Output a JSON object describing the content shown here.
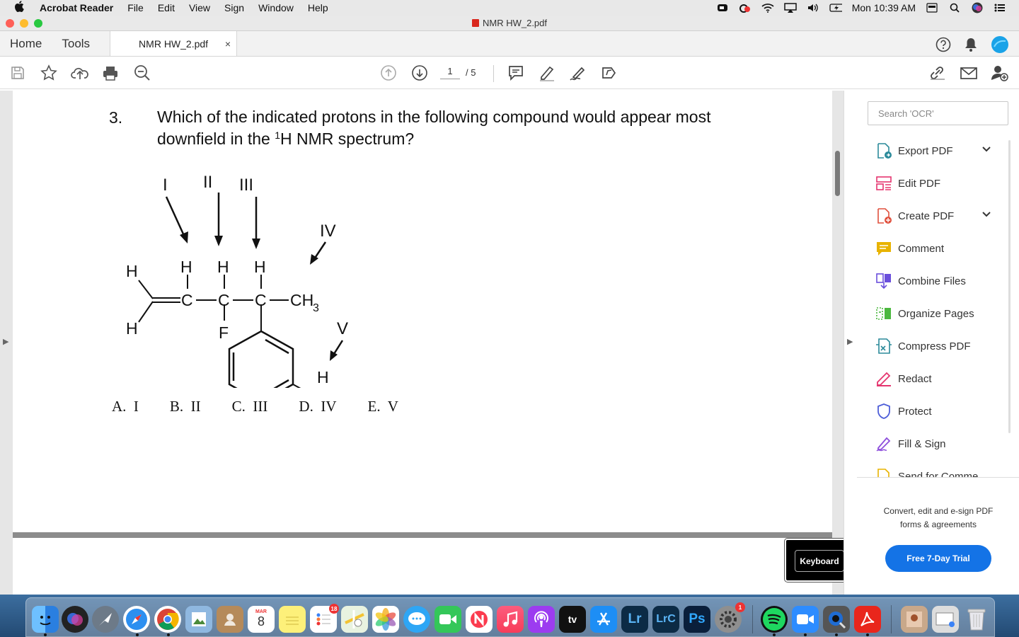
{
  "menubar": {
    "app_name": "Acrobat Reader",
    "menus": [
      "File",
      "Edit",
      "View",
      "Sign",
      "Window",
      "Help"
    ],
    "clock": "Mon 10:39 AM"
  },
  "window": {
    "title": "NMR HW_2.pdf"
  },
  "tabs": {
    "home": "Home",
    "tools": "Tools",
    "document": "NMR HW_2.pdf",
    "close": "×"
  },
  "toolbar": {
    "page_current": "1",
    "page_total": "/ 5"
  },
  "document": {
    "question_number": "3.",
    "question_text_1": "Which of the indicated protons in the following compound would appear most",
    "question_text_2a": "downfield in the ",
    "question_text_sup": "1",
    "question_text_2b": "H NMR spectrum?",
    "labels": {
      "I": "I",
      "II": "II",
      "III": "III",
      "IV": "IV",
      "V": "V",
      "H": "H",
      "C": "C",
      "F": "F",
      "CH": "CH",
      "sub3": "3"
    },
    "answers": [
      "A.  I",
      "B.  II",
      "C.  III",
      "D.  IV",
      "E.  V"
    ]
  },
  "keyboard_popup": "Keyboard",
  "right_panel": {
    "search_placeholder": "Search 'OCR'",
    "tools": [
      {
        "label": "Export PDF",
        "icon": "export-pdf-icon",
        "color": "#2b8a9a",
        "expandable": true
      },
      {
        "label": "Edit PDF",
        "icon": "edit-pdf-icon",
        "color": "#e5356f",
        "expandable": false
      },
      {
        "label": "Create PDF",
        "icon": "create-pdf-icon",
        "color": "#e0513e",
        "expandable": true
      },
      {
        "label": "Comment",
        "icon": "comment-icon",
        "color": "#e8b300",
        "expandable": false
      },
      {
        "label": "Combine Files",
        "icon": "combine-files-icon",
        "color": "#6a4fdc",
        "expandable": false
      },
      {
        "label": "Organize Pages",
        "icon": "organize-pages-icon",
        "color": "#4bb83f",
        "expandable": false
      },
      {
        "label": "Compress PDF",
        "icon": "compress-pdf-icon",
        "color": "#2b8a9a",
        "expandable": false
      },
      {
        "label": "Redact",
        "icon": "redact-icon",
        "color": "#e5356f",
        "expandable": false
      },
      {
        "label": "Protect",
        "icon": "protect-icon",
        "color": "#4e5ed8",
        "expandable": false
      },
      {
        "label": "Fill & Sign",
        "icon": "fill-sign-icon",
        "color": "#8e4fdc",
        "expandable": false
      },
      {
        "label": "Send for Comme",
        "icon": "send-for-comment-icon",
        "color": "#e8b300",
        "expandable": false
      }
    ],
    "promo_line1": "Convert, edit and e-sign PDF",
    "promo_line2": "forms & agreements",
    "trial_button": "Free 7-Day Trial"
  },
  "dock": {
    "calendar_month": "MAR",
    "calendar_day": "8",
    "reminders_badge": "18",
    "prefs_badge": "1",
    "lr": "Lr",
    "lrc": "LrC",
    "ps": "Ps",
    "tv": "tv"
  }
}
